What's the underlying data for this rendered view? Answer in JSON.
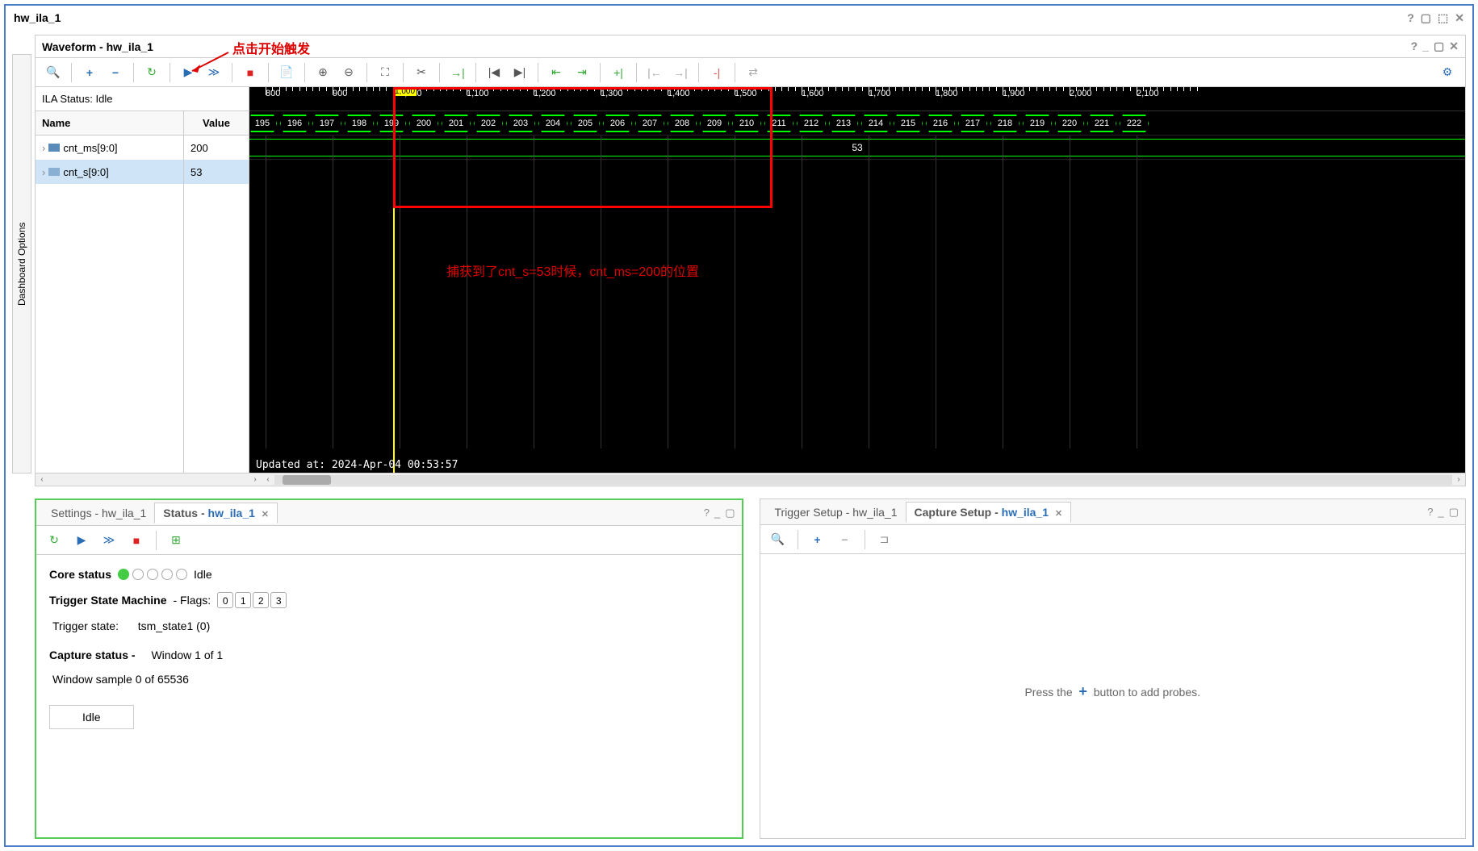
{
  "title": "hw_ila_1",
  "sidebar_label": "Dashboard Options",
  "waveform": {
    "title": "Waveform - hw_ila_1",
    "ila_status_label": "ILA Status:",
    "ila_status_value": "Idle",
    "name_header": "Name",
    "value_header": "Value",
    "signals": [
      {
        "name": "cnt_ms[9:0]",
        "value": "200"
      },
      {
        "name": "cnt_s[9:0]",
        "value": "53"
      }
    ],
    "ruler_ticks": [
      "800",
      "900",
      "1,000",
      "1,100",
      "1,200",
      "1,300",
      "1,400",
      "1,500",
      "1,600",
      "1,700",
      "1,800",
      "1,900",
      "2,000",
      "2,100"
    ],
    "cursor_label": "1,000",
    "bus1_values": [
      "195",
      "196",
      "197",
      "198",
      "199",
      "200",
      "201",
      "202",
      "203",
      "204",
      "205",
      "206",
      "207",
      "208",
      "209",
      "210",
      "211",
      "212",
      "213",
      "214",
      "215",
      "216",
      "217",
      "218",
      "219",
      "220",
      "221",
      "222"
    ],
    "bus2_value": "53",
    "updated": "Updated at: 2024-Apr-04 00:53:57"
  },
  "annotations": {
    "trigger_hint": "点击开始触发",
    "capture_hint": "捕获到了cnt_s=53时候，cnt_ms=200的位置"
  },
  "status_panel": {
    "settings_tab": "Settings - hw_ila_1",
    "status_tab_prefix": "Status - ",
    "status_tab_link": "hw_ila_1",
    "core_status_label": "Core status",
    "core_status_value": "Idle",
    "tsm_label": "Trigger State Machine",
    "tsm_flags_label": "- Flags:",
    "flags": [
      "0",
      "1",
      "2",
      "3"
    ],
    "trigger_state_label": "Trigger state:",
    "trigger_state_value": "tsm_state1 (0)",
    "capture_status_label": "Capture status -",
    "capture_window": "Window 1 of 1",
    "window_sample": "Window sample 0 of 65536",
    "idle_btn": "Idle"
  },
  "capture_panel": {
    "trigger_tab": "Trigger Setup - hw_ila_1",
    "capture_tab_prefix": "Capture Setup - ",
    "capture_tab_link": "hw_ila_1",
    "empty_prefix": "Press the",
    "empty_suffix": "button to add probes."
  }
}
